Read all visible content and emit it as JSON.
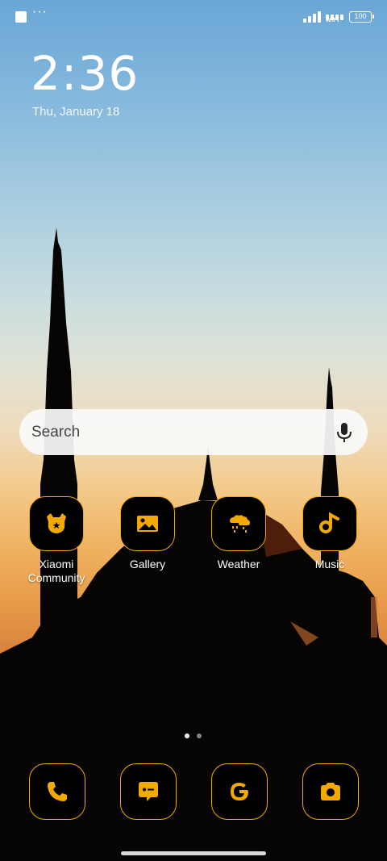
{
  "status_bar": {
    "dots": "···",
    "wifi_label": "WIFI",
    "battery_level": "100"
  },
  "lockscreen": {
    "time": "2:36",
    "date": "Thu, January 18"
  },
  "search": {
    "placeholder": "Search"
  },
  "apps": [
    {
      "label": "Xiaomi Community",
      "icon": "xiaomi-community-icon"
    },
    {
      "label": "Gallery",
      "icon": "gallery-icon"
    },
    {
      "label": "Weather",
      "icon": "weather-icon"
    },
    {
      "label": "Music",
      "icon": "music-icon"
    }
  ],
  "dock": [
    {
      "icon": "phone-icon"
    },
    {
      "icon": "messages-icon"
    },
    {
      "icon": "google-icon"
    },
    {
      "icon": "camera-icon"
    }
  ],
  "page_indicator": {
    "pages": 2,
    "current": 1
  },
  "colors": {
    "icon_accent": "#f2a900",
    "icon_background": "#000000"
  }
}
